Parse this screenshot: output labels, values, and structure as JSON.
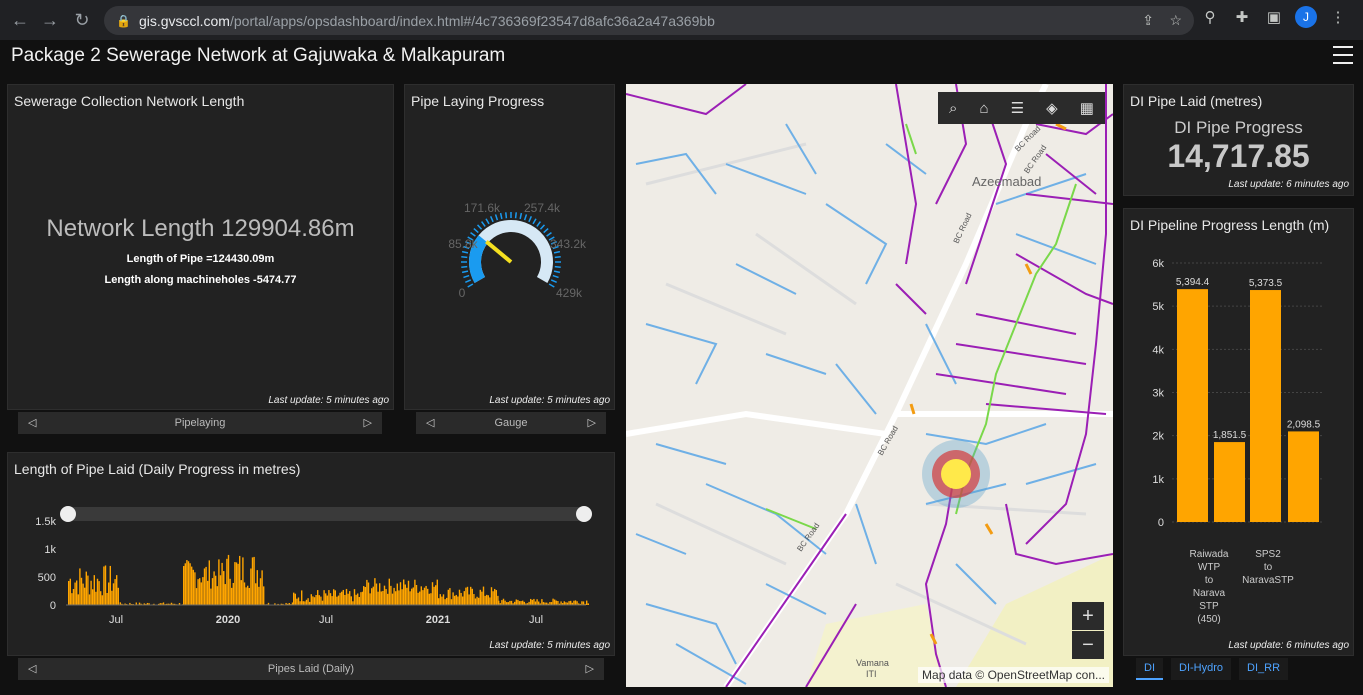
{
  "browser": {
    "url_host": "gis.gvsccl.com",
    "url_path": "/portal/apps/opsdashboard/index.html#/4c736369f23547d8afc36a2a47a369bb",
    "profile_initial": "J"
  },
  "header": {
    "title": "Package 2 Sewerage Network at Gajuwaka & Malkapuram"
  },
  "network_panel": {
    "title": "Sewerage Collection Network Length",
    "main": "Network Length 129904.86m",
    "line1": "Length of Pipe =124430.09m",
    "line2": "Length along machineholes -5474.77",
    "last_update": "Last update: 5 minutes ago",
    "pager_label": "Pipelaying"
  },
  "gauge_panel": {
    "title": "Pipe Laying Progress",
    "labels": [
      "0",
      "85.8k",
      "171.6k",
      "257.4k",
      "343.2k",
      "429k"
    ],
    "value_fraction": 0.29,
    "last_update": "Last update: 5 minutes ago",
    "pager_label": "Gauge"
  },
  "daily_panel": {
    "title": "Length of Pipe Laid (Daily Progress in metres)",
    "y_ticks": [
      "1.5k",
      "1k",
      "500",
      "0"
    ],
    "x_ticks": [
      "Jul",
      "2020",
      "Jul",
      "2021",
      "Jul"
    ],
    "last_update": "Last update: 5 minutes ago",
    "pager_label": "Pipes Laid (Daily)"
  },
  "map": {
    "labels": [
      "Azeemabad",
      "BC Road",
      "BC Road",
      "BC Road",
      "BC Road",
      "BC Road",
      "Vamana",
      "ITI"
    ],
    "attribution": "Map data © OpenStreetMap con...",
    "zoom_in": "+",
    "zoom_out": "−"
  },
  "di_progress_panel": {
    "title": "DI Pipe Laid (metres)",
    "subtitle": "DI Pipe Progress",
    "value": "14,717.85",
    "last_update": "Last update: 6 minutes ago"
  },
  "di_chart_panel": {
    "title": "DI Pipeline Progress Length (m)",
    "last_update": "Last update: 6 minutes ago"
  },
  "tabs": [
    "DI",
    "DI-Hydro",
    "DI_RR"
  ],
  "colors": {
    "bar": "#ffa500",
    "gauge": "#1a9bf0",
    "panel": "#222222"
  },
  "chart_data": {
    "type": "bar",
    "categories": [
      "Raiwada WTP to Narava STP (450)",
      "SPS2 to NaravaSTP"
    ],
    "series": [
      {
        "values": [
          5394.4,
          1851.5
        ]
      },
      {
        "values": [
          5373.5,
          2098.5
        ]
      }
    ],
    "bar_labels": [
      "5,394.4",
      "1,851.5",
      "5,373.5",
      "2,098.5"
    ],
    "bar_values": [
      5394.4,
      1851.5,
      5373.5,
      2098.5
    ],
    "category_labels": [
      [
        "Raiwada",
        "WTP",
        "to",
        "Narava",
        "STP",
        "(450)"
      ],
      [
        "SPS2",
        "to",
        "NaravaSTP"
      ]
    ],
    "y_ticks": [
      "6k",
      "5k",
      "4k",
      "3k",
      "2k",
      "1k",
      "0"
    ],
    "ylim": [
      0,
      6000
    ],
    "grid": true
  }
}
